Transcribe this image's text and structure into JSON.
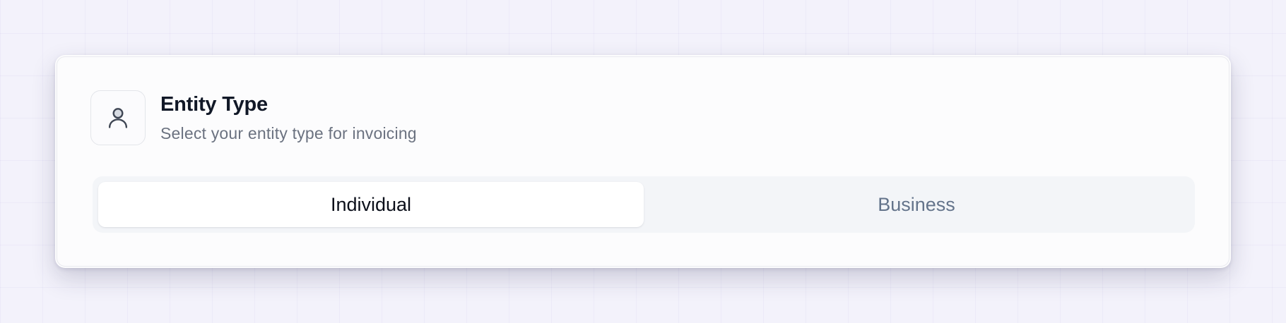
{
  "card": {
    "title": "Entity Type",
    "subtitle": "Select your entity type for invoicing",
    "icon": "user-icon"
  },
  "entity_selector": {
    "options": [
      {
        "label": "Individual",
        "selected": true
      },
      {
        "label": "Business",
        "selected": false
      }
    ]
  },
  "colors": {
    "title": "#111827",
    "subtitle": "#6b7280",
    "selected_text": "#0b0f1a",
    "unselected_text": "#64748b",
    "segment_track": "#f3f5f8"
  }
}
